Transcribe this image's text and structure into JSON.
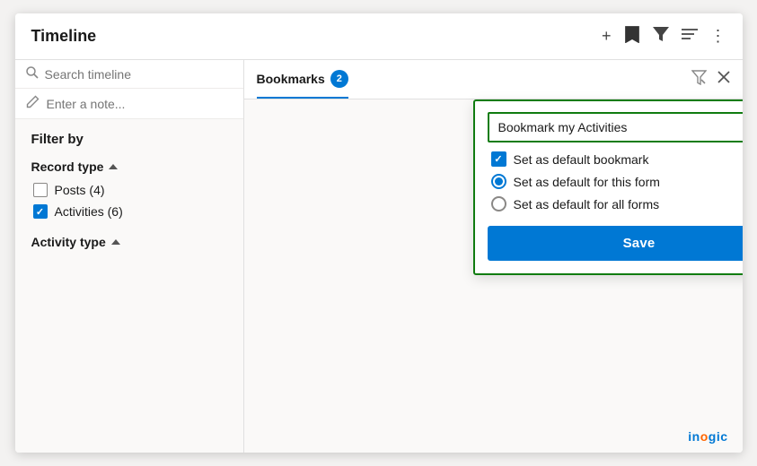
{
  "header": {
    "title": "Timeline",
    "icons": {
      "plus": "+",
      "bookmark": "🔖",
      "filter": "⊍",
      "sort": "≡",
      "more": "⋮"
    }
  },
  "search": {
    "placeholder": "Search timeline",
    "icon": "🔍"
  },
  "note": {
    "placeholder": "Enter a note..."
  },
  "bookmarks_tab": {
    "label": "Bookmarks",
    "count": "2"
  },
  "bookmark_popup": {
    "input_value": "Bookmark my Activities",
    "option1": "Set as default bookmark",
    "option2": "Set as default for this form",
    "option3": "Set as default for all forms",
    "save_label": "Save"
  },
  "filter": {
    "title": "Filter by",
    "record_type_label": "Record type",
    "items": [
      {
        "label": "Posts (4)",
        "checked": false
      },
      {
        "label": "Activities (6)",
        "checked": true
      }
    ],
    "activity_type_label": "Activity type"
  },
  "branding": {
    "logo": "inogic"
  }
}
